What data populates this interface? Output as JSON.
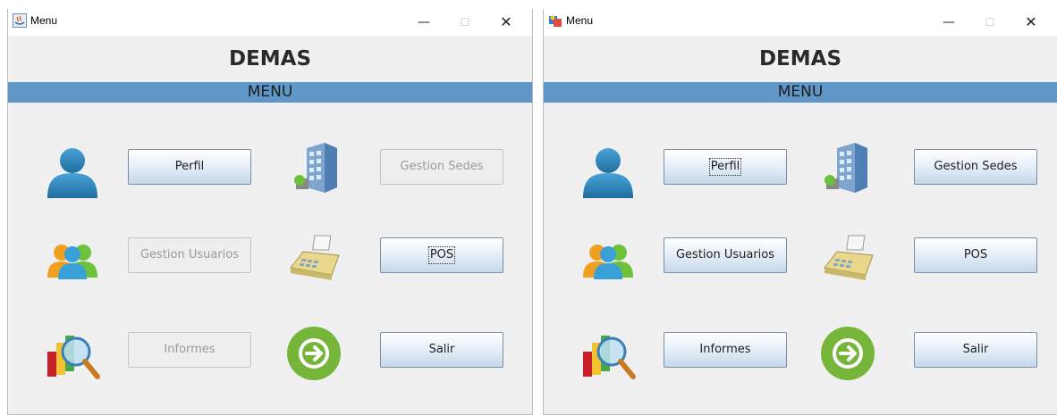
{
  "windows": [
    {
      "title": "Menu",
      "controls": {
        "minimize": "—",
        "maximize": "☐",
        "close": "✕"
      },
      "app_title": "DEMAS",
      "section": "MENU",
      "buttons": {
        "perfil": {
          "label": "Perfil",
          "enabled": true
        },
        "gestion_sedes": {
          "label": "Gestion Sedes",
          "enabled": false
        },
        "gestion_usuarios": {
          "label": "Gestion Usuarios",
          "enabled": false
        },
        "pos": {
          "label": "POS",
          "enabled": true,
          "focused": true
        },
        "informes": {
          "label": "Informes",
          "enabled": false
        },
        "salir": {
          "label": "Salir",
          "enabled": true
        }
      }
    },
    {
      "title": "Menu",
      "controls": {
        "minimize": "—",
        "maximize": "☐",
        "close": "✕"
      },
      "app_title": "DEMAS",
      "section": "MENU",
      "buttons": {
        "perfil": {
          "label": "Perfil",
          "enabled": true,
          "focused": true
        },
        "gestion_sedes": {
          "label": "Gestion Sedes",
          "enabled": true
        },
        "gestion_usuarios": {
          "label": "Gestion Usuarios",
          "enabled": true
        },
        "pos": {
          "label": "POS",
          "enabled": true
        },
        "informes": {
          "label": "Informes",
          "enabled": true
        },
        "salir": {
          "label": "Salir",
          "enabled": true
        }
      }
    }
  ],
  "icons": {
    "perfil": "user-profile-icon",
    "sedes": "office-building-icon",
    "usuarios": "users-group-icon",
    "pos": "cash-register-icon",
    "informes": "report-search-icon",
    "salir": "exit-arrow-icon"
  },
  "colors": {
    "menu_band": "#5f98c8",
    "button_gradient_top": "#ffffff",
    "button_gradient_bottom": "#c6d7ea",
    "disabled_text": "#9a9a9a",
    "window_bg": "#f0f0f0"
  }
}
